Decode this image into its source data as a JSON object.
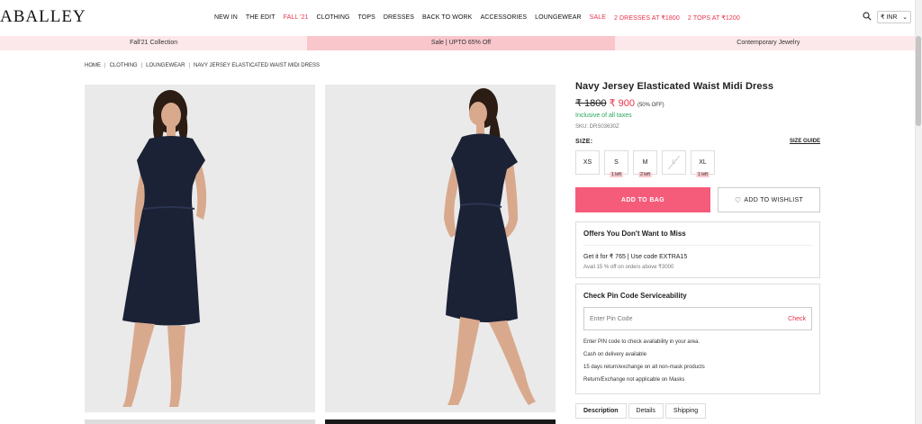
{
  "header": {
    "logo": "ABALLEY",
    "nav": [
      {
        "label": "NEW IN",
        "red": false
      },
      {
        "label": "THE EDIT",
        "red": false
      },
      {
        "label": "FALL '21",
        "red": true
      },
      {
        "label": "CLOTHING",
        "red": false
      },
      {
        "label": "TOPS",
        "red": false
      },
      {
        "label": "DRESSES",
        "red": false
      },
      {
        "label": "BACK TO WORK",
        "red": false
      },
      {
        "label": "ACCESSORIES",
        "red": false
      },
      {
        "label": "LOUNGEWEAR",
        "red": false
      },
      {
        "label": "SALE",
        "red": true
      },
      {
        "label": "2 DRESSES AT ₹1800",
        "red": true
      },
      {
        "label": "2 TOPS AT ₹1200",
        "red": true
      }
    ],
    "currency": "₹ INR"
  },
  "promo": [
    "Fall'21 Collection",
    "Sale | UPTO 65% Off",
    "Contemporary Jewelry"
  ],
  "breadcrumb": [
    "HOME",
    "CLOTHING",
    "LOUNGEWEAR",
    "NAVY JERSEY ELASTICATED WAIST MIDI DRESS"
  ],
  "product": {
    "title": "Navy Jersey Elasticated Waist Midi Dress",
    "mrp": "₹ 1800",
    "sale_price": "₹ 900",
    "discount": "(50% OFF)",
    "tax_note": "Inclusive of all taxes",
    "sku": "SKU: DRS03630Z",
    "size_label": "SIZE:",
    "size_guide": "SIZE GUIDE",
    "sizes": [
      {
        "label": "XS",
        "left": "",
        "disabled": false
      },
      {
        "label": "S",
        "left": "1 left",
        "disabled": false
      },
      {
        "label": "M",
        "left": "2 left",
        "disabled": false
      },
      {
        "label": "L",
        "left": "",
        "disabled": true
      },
      {
        "label": "XL",
        "left": "1 left",
        "disabled": false
      }
    ],
    "add_to_bag": "ADD TO BAG",
    "add_to_wishlist": "ADD TO WISHLIST"
  },
  "offers": {
    "title": "Offers You Don't Want to Miss",
    "line": "Get it for ₹ 765 | Use code EXTRA15",
    "sub": "Avail 15 % off on orders above ₹3000"
  },
  "pincode": {
    "title": "Check Pin Code Serviceability",
    "placeholder": "Enter Pin Code",
    "check": "Check",
    "notes": [
      "Enter PIN code to check availability in your area.",
      "Cash on delivery available",
      "15 days return/exchange on all non-mask products",
      "Return/Exchange not applicable on Masks"
    ]
  },
  "tabs": [
    "Description",
    "Details",
    "Shipping"
  ],
  "colors": {
    "accent": "#f45c7a",
    "sale_red": "#e8334a",
    "promo_bg": "#fce8ea",
    "dress": "#1b2236"
  }
}
